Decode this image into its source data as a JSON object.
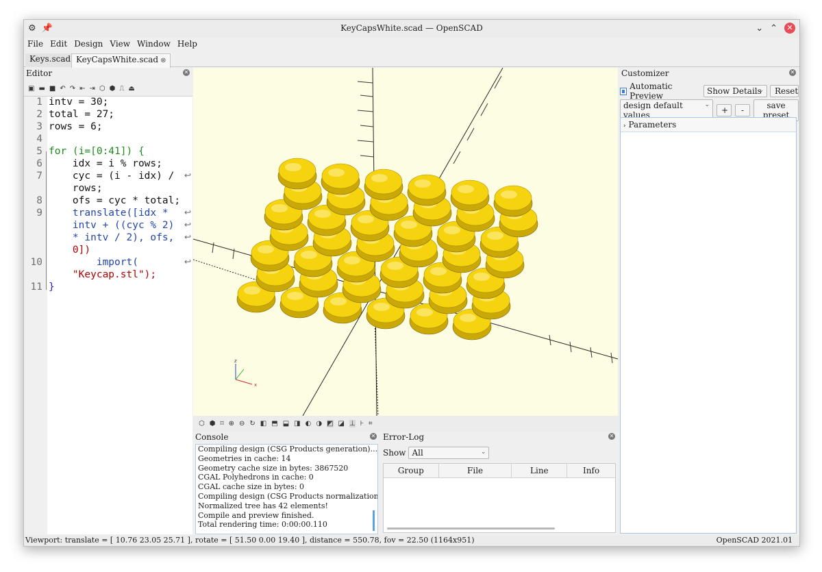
{
  "window": {
    "title": "KeyCapsWhite.scad — OpenSCAD"
  },
  "menu": [
    "File",
    "Edit",
    "Design",
    "View",
    "Window",
    "Help"
  ],
  "tabs": [
    {
      "label": "Keys.scad",
      "active": false
    },
    {
      "label": "KeyCapsWhite.scad",
      "active": true
    }
  ],
  "editor": {
    "title": "Editor",
    "lines": [
      {
        "n": "1",
        "text": "intv = 30;"
      },
      {
        "n": "2",
        "text": "total = 27;"
      },
      {
        "n": "3",
        "text": "rows = 6;"
      },
      {
        "n": "4",
        "text": ""
      },
      {
        "n": "5",
        "text": "for (i=[0:41]) {"
      },
      {
        "n": "6",
        "text": "    idx = i % rows;"
      },
      {
        "n": "7",
        "text": "    cyc = (i - idx) /"
      },
      {
        "n": "",
        "text": "    rows;"
      },
      {
        "n": "8",
        "text": "    ofs = cyc * total;"
      },
      {
        "n": "9",
        "text": "    translate([idx *"
      },
      {
        "n": "",
        "text": "    intv + ((cyc % 2)"
      },
      {
        "n": "",
        "text": "    * intv / 2), ofs,"
      },
      {
        "n": "",
        "text": "    0])"
      },
      {
        "n": "10",
        "text": "        import("
      },
      {
        "n": "",
        "text": "    \"Keycap.stl\");"
      },
      {
        "n": "11",
        "text": "}"
      }
    ]
  },
  "console": {
    "title": "Console",
    "lines": [
      "Compiling design (CSG Products generation)...",
      "Geometries in cache: 14",
      "Geometry cache size in bytes: 3867520",
      "CGAL Polyhedrons in cache: 0",
      "CGAL cache size in bytes: 0",
      "Compiling design (CSG Products normalization)...",
      "Normalized tree has 42 elements!",
      "Compile and preview finished.",
      "Total rendering time: 0:00:00.110"
    ]
  },
  "errorlog": {
    "title": "Error-Log",
    "show_label": "Show",
    "show_value": "All",
    "columns": [
      "Group",
      "File",
      "Line",
      "Info"
    ]
  },
  "customizer": {
    "title": "Customizer",
    "auto_preview_label": "Automatic Preview",
    "auto_preview_checked": true,
    "details_value": "Show Details",
    "reset_label": "Reset",
    "preset_value": "design default values",
    "plus_label": "+",
    "minus_label": "-",
    "save_preset_label": "save preset",
    "parameters_label": "Parameters"
  },
  "viewport": {
    "axis_label_z": "z",
    "axis_label_x": "x",
    "keycap_count": 42,
    "keycap_color": "#f5d40f",
    "background_color": "#fdfde3"
  },
  "statusbar": {
    "left": "Viewport: translate = [ 10.76 23.05 25.71 ], rotate = [ 51.50 0.00 19.40 ], distance = 550.78, fov = 22.50 (1164x951)",
    "right": "OpenSCAD 2021.01"
  }
}
